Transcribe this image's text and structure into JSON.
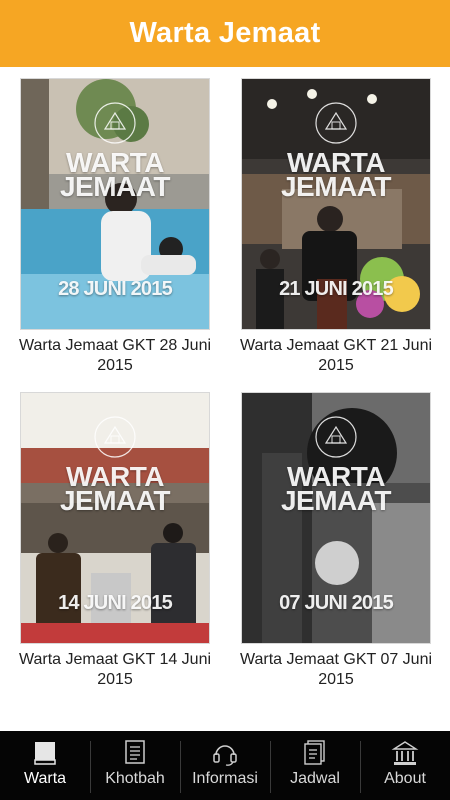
{
  "app_bar": {
    "title": "Warta Jemaat"
  },
  "cards": [
    {
      "overlay_title": "WARTA\nJEMAAT",
      "overlay_date": "28 JUNI 2015",
      "caption": "Warta Jemaat GKT 28 Juni 2015"
    },
    {
      "overlay_title": "WARTA\nJEMAAT",
      "overlay_date": "21 JUNI 2015",
      "caption": "Warta Jemaat GKT 21 Juni 2015"
    },
    {
      "overlay_title": "WARTA\nJEMAAT",
      "overlay_date": "14 JUNI 2015",
      "caption": "Warta Jemaat GKT 14 Juni 2015"
    },
    {
      "overlay_title": "WARTA\nJEMAAT",
      "overlay_date": "07 JUNI 2015",
      "caption": "Warta Jemaat GKT 07 Juni 2015"
    }
  ],
  "bottom_nav": {
    "items": [
      {
        "label": "Warta",
        "icon": "book-icon",
        "active": true
      },
      {
        "label": "Khotbah",
        "icon": "document-icon",
        "active": false
      },
      {
        "label": "Informasi",
        "icon": "headset-icon",
        "active": false
      },
      {
        "label": "Jadwal",
        "icon": "schedule-icon",
        "active": false
      },
      {
        "label": "About",
        "icon": "building-icon",
        "active": false
      }
    ]
  },
  "colors": {
    "app_bar": "#f6a623",
    "nav_bg": "#050505",
    "nav_text": "#d9d9d9"
  }
}
